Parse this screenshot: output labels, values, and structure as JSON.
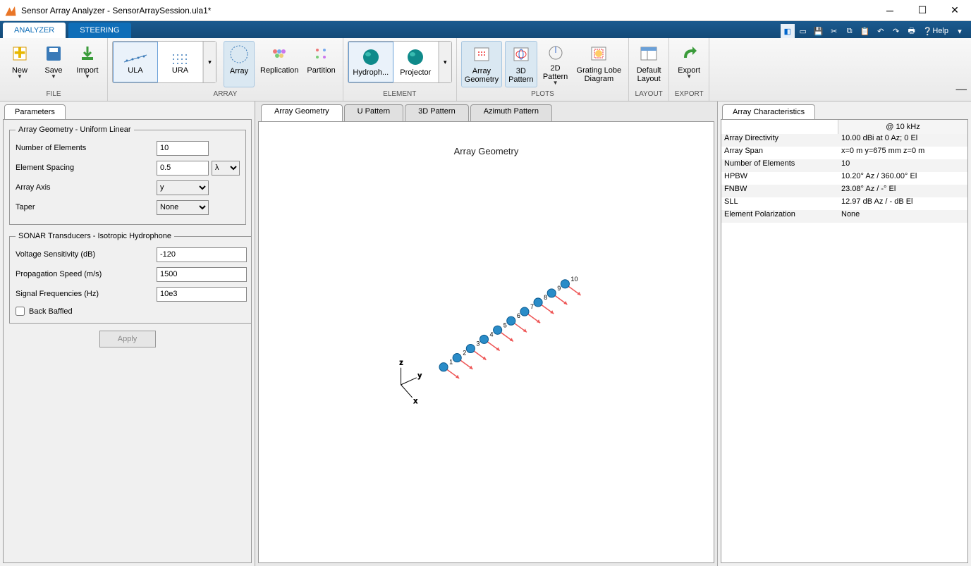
{
  "window": {
    "title": "Sensor Array Analyzer - SensorArraySession.ula1*"
  },
  "tabs": {
    "analyzer": "ANALYZER",
    "steering": "STEERING"
  },
  "help_label": "Help",
  "ribbon": {
    "file": {
      "new": "New",
      "save": "Save",
      "import": "Import",
      "label": "FILE"
    },
    "array": {
      "ula": "ULA",
      "ura": "URA",
      "arraybtn": "Array",
      "replication": "Replication",
      "partition": "Partition",
      "label": "ARRAY"
    },
    "element": {
      "hydrophone": "Hydroph...",
      "projector": "Projector",
      "label": "ELEMENT"
    },
    "plots": {
      "geometry": "Array\nGeometry",
      "3d": "3D\nPattern",
      "2d": "2D\nPattern",
      "grating": "Grating Lobe\nDiagram",
      "label": "PLOTS"
    },
    "layout": {
      "default": "Default\nLayout",
      "label": "LAYOUT"
    },
    "export": {
      "export": "Export",
      "label": "EXPORT"
    }
  },
  "parameters_tab": "Parameters",
  "form": {
    "geom_legend": "Array Geometry - Uniform Linear",
    "num_elements_label": "Number of Elements",
    "num_elements": "10",
    "spacing_label": "Element Spacing",
    "spacing": "0.5",
    "spacing_unit": "λ",
    "axis_label": "Array Axis",
    "axis": "y",
    "taper_label": "Taper",
    "taper": "None",
    "sonar_legend": "SONAR Transducers - Isotropic Hydrophone",
    "voltage_label": "Voltage Sensitivity (dB)",
    "voltage": "-120",
    "speed_label": "Propagation Speed (m/s)",
    "speed": "1500",
    "freq_label": "Signal Frequencies (Hz)",
    "freq": "10e3",
    "baffled_label": "Back Baffled",
    "apply": "Apply"
  },
  "center_tabs": [
    "Array Geometry",
    "U Pattern",
    "3D Pattern",
    "Azimuth Pattern"
  ],
  "plot_title": "Array Geometry",
  "axis_labels": {
    "x": "x",
    "y": "y",
    "z": "z"
  },
  "array_characteristics_tab": "Array Characteristics",
  "char_header": "@ 10 kHz",
  "characteristics": [
    {
      "k": "Array Directivity",
      "v": "10.00 dBi at 0 Az; 0 El"
    },
    {
      "k": "Array Span",
      "v": "x=0 m y=675 mm z=0 m"
    },
    {
      "k": "Number of Elements",
      "v": "10"
    },
    {
      "k": "HPBW",
      "v": "10.20° Az / 360.00° El"
    },
    {
      "k": "FNBW",
      "v": "23.08° Az / -° El"
    },
    {
      "k": "SLL",
      "v": "12.97 dB Az / - dB El"
    },
    {
      "k": "Element Polarization",
      "v": "None"
    }
  ]
}
